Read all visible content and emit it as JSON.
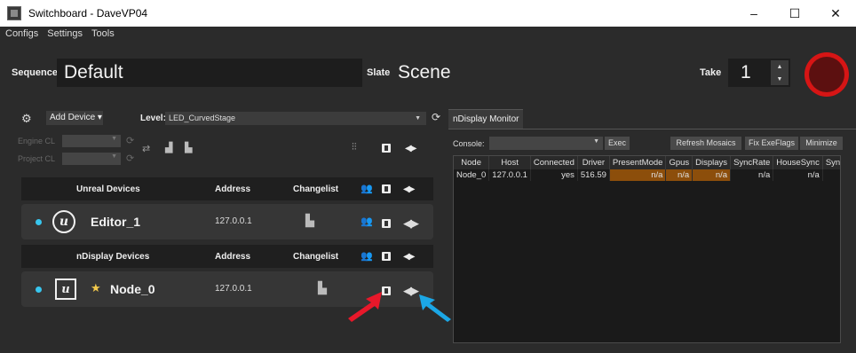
{
  "window": {
    "title": "Switchboard - DaveVP04",
    "minimize": "–",
    "maximize": "☐",
    "close": "✕"
  },
  "menu": {
    "items": [
      "Configs",
      "Settings",
      "Tools"
    ]
  },
  "header": {
    "sequence_label": "Sequence",
    "sequence_value": "Default",
    "slate_label": "Slate",
    "slate_value": "Scene",
    "take_label": "Take",
    "take_value": "1"
  },
  "left": {
    "add_device": "Add Device ▾",
    "level_label": "Level:",
    "level_value": "LED_CurvedStage",
    "engine_cl": "Engine CL",
    "project_cl": "Project CL",
    "unreal_header": {
      "title": "Unreal Devices",
      "address": "Address",
      "changelist": "Changelist"
    },
    "unreal_device": {
      "name": "Editor_1",
      "address": "127.0.0.1"
    },
    "ndisplay_header": {
      "title": "nDisplay Devices",
      "address": "Address",
      "changelist": "Changelist"
    },
    "ndisplay_device": {
      "name": "Node_0",
      "address": "127.0.0.1"
    }
  },
  "right": {
    "tab": "nDisplay Monitor",
    "console_label": "Console:",
    "exec": "Exec",
    "refresh_mosaics": "Refresh Mosaics",
    "fix_exe_flags": "Fix ExeFlags",
    "minimize": "Minimize",
    "table": {
      "headers": [
        "Node",
        "Host",
        "Connected",
        "Driver",
        "PresentMode",
        "Gpus",
        "Displays",
        "SyncRate",
        "HouseSync",
        "Sync"
      ],
      "rows": [
        {
          "node": "Node_0",
          "host": "127.0.0.1",
          "connected": "yes",
          "driver": "516.59",
          "present_mode": "n/a",
          "gpus": "n/a",
          "displays": "n/a",
          "sync_rate": "n/a",
          "house_sync": "n/a",
          "sync": ""
        }
      ]
    }
  },
  "colors": {
    "accent_dot": "#38c6ee",
    "record": "#d61515",
    "warn_cell": "#8c4e0b",
    "red_arrow": "#e8182a",
    "blue_arrow": "#1ba7e6"
  }
}
